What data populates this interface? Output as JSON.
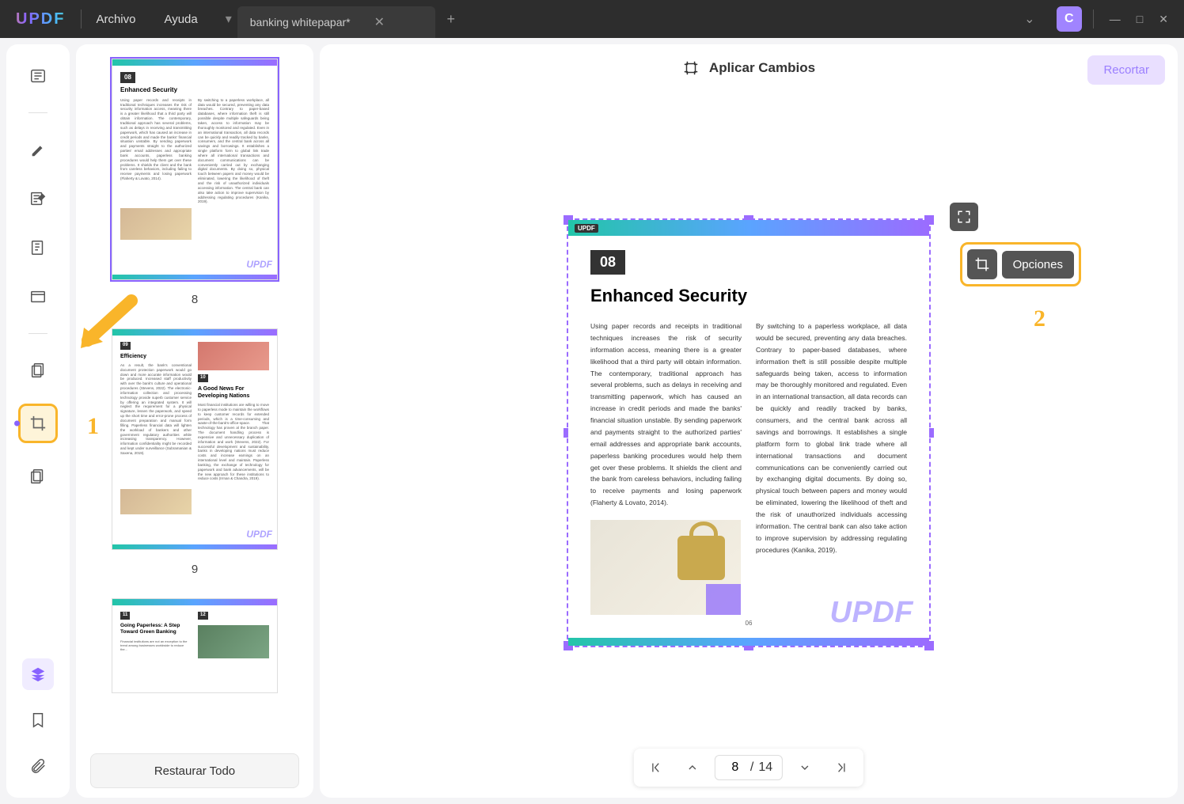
{
  "app": {
    "logo": "UPDF",
    "menu": {
      "archivo": "Archivo",
      "ayuda": "Ayuda"
    },
    "tab_title": "banking whitepapar*",
    "avatar_initial": "C"
  },
  "toolbar_top": {
    "apply_changes": "Aplicar Cambios",
    "crop_button": "Recortar"
  },
  "float": {
    "options_label": "Opciones"
  },
  "annotations": {
    "one": "1",
    "two": "2"
  },
  "page_nav": {
    "current": "8",
    "separator": "/",
    "total": "14"
  },
  "thumbs": {
    "restore_all": "Restaurar Todo",
    "p8": {
      "num": "08",
      "title": "Enhanced Security",
      "label": "8"
    },
    "p9": {
      "num": "09",
      "title": "Efficiency",
      "sub_num": "10",
      "sub_title": "A Good News For Developing Nations",
      "label": "9"
    },
    "p10": {
      "num": "11",
      "title": "Going Paperless: A Step Toward Green Banking",
      "sub_num": "12"
    },
    "watermark": "UPDF"
  },
  "document": {
    "page_num": "08",
    "title": "Enhanced Security",
    "brand": "UPDF",
    "footer_page": "06",
    "watermark": "UPDF",
    "col1": "Using paper records and receipts in traditional techniques increases the risk of security information access, meaning there is a greater likelihood that a third party will obtain information. The contemporary, traditional approach has several problems, such as delays in receiving and transmitting paperwork, which has caused an increase in credit periods and made the banks' financial situation unstable. By sending paperwork and payments straight to the authorized parties' email addresses and appropriate bank accounts, paperless banking procedures would help them get over these problems. It shields the client and the bank from careless behaviors, including failing to receive payments and losing paperwork (Flaherty & Lovato, 2014).",
    "col2": "By switching to a paperless workplace, all data would be secured, preventing any data breaches. Contrary to paper-based databases, where information theft is still possible despite multiple safeguards being taken, access to information may be thoroughly monitored and regulated. Even in an international transaction, all data records can be quickly and readily tracked by banks, consumers, and the central bank across all savings and borrowings. It establishes a single platform form to global link trade where all international transactions and document communications can be conveniently carried out by exchanging digital documents. By doing so, physical touch between papers and money would be eliminated, lowering the likelihood of theft and the risk of unauthorized individuals accessing information. The central bank can also take action to improve supervision by addressing regulating procedures (Kanika, 2019)."
  },
  "thumb_filler": {
    "t8c1": "Using paper records and receipts in traditional techniques increases the risk of security information access, meaning there is a greater likelihood that a third party will obtain information. The contemporary, traditional approach has several problems, such as delays in receiving and transmitting paperwork, which has caused an increase in credit periods and made the banks' financial situation unstable. By sending paperwork and payments straight to the authorized parties' email addresses and appropriate bank accounts, paperless banking procedures would help them get over these problems. It shields the client and the bank from careless behaviors, including failing to receive payments and losing paperwork (Flaherty & Lovato, 2014).",
    "t8c2": "By switching to a paperless workplace, all data would be secured, preventing any data breaches. Contrary to paper-based databases, where information theft is still possible despite multiple safeguards being taken, access to information may be thoroughly monitored and regulated. Even in an international transaction, all data records can be quickly and readily tracked by banks, consumers, and the central bank across all savings and borrowings. It establishes a single platform form to global link trade where all international transactions and document communications can be conveniently carried out by exchanging digital documents. By doing so, physical touch between papers and money would be eliminated, lowering the likelihood of theft and the risk of unauthorized individuals accessing information. The central bank can also take action to improve supervision by addressing regulating procedures (Kanika, 2019).",
    "t9c1": "As a result, the bank's conventional document protection paperwork would go down and more accurate information would be produced. Increased staff productivity with over the bank's culture and operational procedures (Stevens, 2022). The electronic-information collection and processing technology provide superb customer service by offering an integrated system. It will neglect the requirement for a physical signature, lessen the paperwork, and speed up the short time and error-prone process of document preparation and manual form filling. Paperless financial data will lighten the workload of bankers and other government regulatory authorities while increasing transparency. However, information confidentiality might be recorded and kept under surveillance (Subramanian & Saxena, 2019).",
    "t9c2": "Most financial institutions are willing to move to paperless mode to maintain the workflows to keep customer records for extended periods, which is a time-consuming and waste-of-the-bank's-office-space. That technology has proven al the branch paper. The document handling process is expensive and unnecessary duplication of information and work (Stevens, 2022). For successful development and sustainability, banks in developing nations must reduce costs and increase earnings on an international level and maintain. Paperless banking, the exchange of technology for paperwork and bank advancements, will be the new approach for these institutions to reduce costs (Irrnan & Chandra, 2019)."
  }
}
